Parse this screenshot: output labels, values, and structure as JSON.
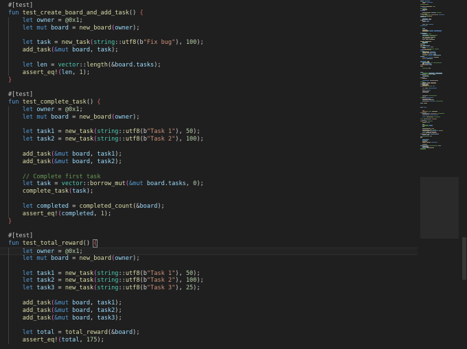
{
  "editor": {
    "language": "move",
    "lines": [
      [
        [
          "#[test]",
          "attr"
        ]
      ],
      [
        [
          "fun ",
          "kw"
        ],
        [
          "test_create_board_and_add_task",
          "fn"
        ],
        [
          "() ",
          "punct"
        ],
        [
          "{",
          "brace"
        ]
      ],
      [
        [
          "    let ",
          "kw"
        ],
        [
          "owner",
          "var"
        ],
        [
          " = ",
          "punct"
        ],
        [
          "@0x1",
          "num"
        ],
        [
          ";",
          "punct"
        ]
      ],
      [
        [
          "    let mut ",
          "kw"
        ],
        [
          "board",
          "var"
        ],
        [
          " = ",
          "punct"
        ],
        [
          "new_board",
          "fn"
        ],
        [
          "(",
          "paren"
        ],
        [
          "owner",
          "var"
        ],
        [
          ");",
          "punct"
        ]
      ],
      [
        [
          "",
          ""
        ]
      ],
      [
        [
          "    let ",
          "kw"
        ],
        [
          "task",
          "var"
        ],
        [
          " = ",
          "punct"
        ],
        [
          "new_task",
          "fn"
        ],
        [
          "(",
          "paren"
        ],
        [
          "string",
          "ns"
        ],
        [
          "::",
          "punct"
        ],
        [
          "utf8",
          "fn"
        ],
        [
          "(b",
          "punct"
        ],
        [
          "\"Fix bug\"",
          "str"
        ],
        [
          "), ",
          "punct"
        ],
        [
          "100",
          "num"
        ],
        [
          ");",
          "punct"
        ]
      ],
      [
        [
          "    ",
          "punct"
        ],
        [
          "add_task",
          "fn"
        ],
        [
          "(",
          "paren"
        ],
        [
          "&mut ",
          "kw"
        ],
        [
          "board",
          "var"
        ],
        [
          ", ",
          "punct"
        ],
        [
          "task",
          "var"
        ],
        [
          ");",
          "punct"
        ]
      ],
      [
        [
          "",
          ""
        ]
      ],
      [
        [
          "    let ",
          "kw"
        ],
        [
          "len",
          "var"
        ],
        [
          " = ",
          "punct"
        ],
        [
          "vector",
          "ns"
        ],
        [
          "::",
          "punct"
        ],
        [
          "length",
          "fn"
        ],
        [
          "(&",
          "punct"
        ],
        [
          "board",
          "var"
        ],
        [
          ".",
          "punct"
        ],
        [
          "tasks",
          "var"
        ],
        [
          ");",
          "punct"
        ]
      ],
      [
        [
          "    ",
          "punct"
        ],
        [
          "assert_eq!",
          "macro"
        ],
        [
          "(",
          "paren"
        ],
        [
          "len",
          "var"
        ],
        [
          ", ",
          "punct"
        ],
        [
          "1",
          "num"
        ],
        [
          ");",
          "punct"
        ]
      ],
      [
        [
          "}",
          "brace"
        ]
      ],
      [
        [
          "",
          ""
        ]
      ],
      [
        [
          "#[test]",
          "attr"
        ]
      ],
      [
        [
          "fun ",
          "kw"
        ],
        [
          "test_complete_task",
          "fn"
        ],
        [
          "() ",
          "punct"
        ],
        [
          "{",
          "brace"
        ]
      ],
      [
        [
          "    let ",
          "kw"
        ],
        [
          "owner",
          "var"
        ],
        [
          " = ",
          "punct"
        ],
        [
          "@0x1",
          "num"
        ],
        [
          ";",
          "punct"
        ]
      ],
      [
        [
          "    let mut ",
          "kw"
        ],
        [
          "board",
          "var"
        ],
        [
          " = ",
          "punct"
        ],
        [
          "new_board",
          "fn"
        ],
        [
          "(",
          "paren"
        ],
        [
          "owner",
          "var"
        ],
        [
          ");",
          "punct"
        ]
      ],
      [
        [
          "",
          ""
        ]
      ],
      [
        [
          "    let ",
          "kw"
        ],
        [
          "task1",
          "var"
        ],
        [
          " = ",
          "punct"
        ],
        [
          "new_task",
          "fn"
        ],
        [
          "(",
          "paren"
        ],
        [
          "string",
          "ns"
        ],
        [
          "::",
          "punct"
        ],
        [
          "utf8",
          "fn"
        ],
        [
          "(b",
          "punct"
        ],
        [
          "\"Task 1\"",
          "str"
        ],
        [
          "), ",
          "punct"
        ],
        [
          "50",
          "num"
        ],
        [
          ");",
          "punct"
        ]
      ],
      [
        [
          "    let ",
          "kw"
        ],
        [
          "task2",
          "var"
        ],
        [
          " = ",
          "punct"
        ],
        [
          "new_task",
          "fn"
        ],
        [
          "(",
          "paren"
        ],
        [
          "string",
          "ns"
        ],
        [
          "::",
          "punct"
        ],
        [
          "utf8",
          "fn"
        ],
        [
          "(b",
          "punct"
        ],
        [
          "\"Task 2\"",
          "str"
        ],
        [
          "), ",
          "punct"
        ],
        [
          "100",
          "num"
        ],
        [
          ");",
          "punct"
        ]
      ],
      [
        [
          "",
          ""
        ]
      ],
      [
        [
          "    ",
          "punct"
        ],
        [
          "add_task",
          "fn"
        ],
        [
          "(",
          "paren"
        ],
        [
          "&mut ",
          "kw"
        ],
        [
          "board",
          "var"
        ],
        [
          ", ",
          "punct"
        ],
        [
          "task1",
          "var"
        ],
        [
          ");",
          "punct"
        ]
      ],
      [
        [
          "    ",
          "punct"
        ],
        [
          "add_task",
          "fn"
        ],
        [
          "(",
          "paren"
        ],
        [
          "&mut ",
          "kw"
        ],
        [
          "board",
          "var"
        ],
        [
          ", ",
          "punct"
        ],
        [
          "task2",
          "var"
        ],
        [
          ");",
          "punct"
        ]
      ],
      [
        [
          "",
          ""
        ]
      ],
      [
        [
          "    // Complete first task",
          "cmt"
        ]
      ],
      [
        [
          "    let ",
          "kw"
        ],
        [
          "task",
          "var"
        ],
        [
          " = ",
          "punct"
        ],
        [
          "vector",
          "ns"
        ],
        [
          "::",
          "punct"
        ],
        [
          "borrow_mut",
          "fn"
        ],
        [
          "(",
          "paren"
        ],
        [
          "&mut ",
          "kw"
        ],
        [
          "board",
          "var"
        ],
        [
          ".",
          "punct"
        ],
        [
          "tasks",
          "var"
        ],
        [
          ", ",
          "punct"
        ],
        [
          "0",
          "num"
        ],
        [
          ");",
          "punct"
        ]
      ],
      [
        [
          "    ",
          "punct"
        ],
        [
          "complete_task",
          "fn"
        ],
        [
          "(",
          "paren"
        ],
        [
          "task",
          "var"
        ],
        [
          ");",
          "punct"
        ]
      ],
      [
        [
          "",
          ""
        ]
      ],
      [
        [
          "    let ",
          "kw"
        ],
        [
          "completed",
          "var"
        ],
        [
          " = ",
          "punct"
        ],
        [
          "completed_count",
          "fn"
        ],
        [
          "(&",
          "punct"
        ],
        [
          "board",
          "var"
        ],
        [
          ");",
          "punct"
        ]
      ],
      [
        [
          "    ",
          "punct"
        ],
        [
          "assert_eq!",
          "macro"
        ],
        [
          "(",
          "paren"
        ],
        [
          "completed",
          "var"
        ],
        [
          ", ",
          "punct"
        ],
        [
          "1",
          "num"
        ],
        [
          ");",
          "punct"
        ]
      ],
      [
        [
          "}",
          "brace"
        ]
      ],
      [
        [
          "",
          ""
        ]
      ],
      [
        [
          "#[test]",
          "attr"
        ]
      ],
      [
        [
          "fun ",
          "kw"
        ],
        [
          "test_total_reward",
          "fn"
        ],
        [
          "() ",
          "punct"
        ],
        [
          "{",
          "brace-box"
        ]
      ],
      [
        [
          "    let ",
          "kw"
        ],
        [
          "owner",
          "var"
        ],
        [
          " = ",
          "punct"
        ],
        [
          "@0x1",
          "num"
        ],
        [
          ";",
          "punct"
        ]
      ],
      [
        [
          "    let mut ",
          "kw"
        ],
        [
          "board",
          "var"
        ],
        [
          " = ",
          "punct"
        ],
        [
          "new_board",
          "fn"
        ],
        [
          "(",
          "paren"
        ],
        [
          "owner",
          "var"
        ],
        [
          ");",
          "punct"
        ]
      ],
      [
        [
          "",
          ""
        ]
      ],
      [
        [
          "    let ",
          "kw"
        ],
        [
          "task1",
          "var"
        ],
        [
          " = ",
          "punct"
        ],
        [
          "new_task",
          "fn"
        ],
        [
          "(",
          "paren"
        ],
        [
          "string",
          "ns"
        ],
        [
          "::",
          "punct"
        ],
        [
          "utf8",
          "fn"
        ],
        [
          "(b",
          "punct"
        ],
        [
          "\"Task 1\"",
          "str"
        ],
        [
          "), ",
          "punct"
        ],
        [
          "50",
          "num"
        ],
        [
          ");",
          "punct"
        ]
      ],
      [
        [
          "    let ",
          "kw"
        ],
        [
          "task2",
          "var"
        ],
        [
          " = ",
          "punct"
        ],
        [
          "new_task",
          "fn"
        ],
        [
          "(",
          "paren"
        ],
        [
          "string",
          "ns"
        ],
        [
          "::",
          "punct"
        ],
        [
          "utf8",
          "fn"
        ],
        [
          "(b",
          "punct"
        ],
        [
          "\"Task 2\"",
          "str"
        ],
        [
          "), ",
          "punct"
        ],
        [
          "100",
          "num"
        ],
        [
          ");",
          "punct"
        ]
      ],
      [
        [
          "    let ",
          "kw"
        ],
        [
          "task3",
          "var"
        ],
        [
          " = ",
          "punct"
        ],
        [
          "new_task",
          "fn"
        ],
        [
          "(",
          "paren"
        ],
        [
          "string",
          "ns"
        ],
        [
          "::",
          "punct"
        ],
        [
          "utf8",
          "fn"
        ],
        [
          "(b",
          "punct"
        ],
        [
          "\"Task 3\"",
          "str"
        ],
        [
          "), ",
          "punct"
        ],
        [
          "25",
          "num"
        ],
        [
          ");",
          "punct"
        ]
      ],
      [
        [
          "",
          ""
        ]
      ],
      [
        [
          "    ",
          "punct"
        ],
        [
          "add_task",
          "fn"
        ],
        [
          "(",
          "paren"
        ],
        [
          "&mut ",
          "kw"
        ],
        [
          "board",
          "var"
        ],
        [
          ", ",
          "punct"
        ],
        [
          "task1",
          "var"
        ],
        [
          ");",
          "punct"
        ]
      ],
      [
        [
          "    ",
          "punct"
        ],
        [
          "add_task",
          "fn"
        ],
        [
          "(",
          "paren"
        ],
        [
          "&mut ",
          "kw"
        ],
        [
          "board",
          "var"
        ],
        [
          ", ",
          "punct"
        ],
        [
          "task2",
          "var"
        ],
        [
          ");",
          "punct"
        ]
      ],
      [
        [
          "    ",
          "punct"
        ],
        [
          "add_task",
          "fn"
        ],
        [
          "(",
          "paren"
        ],
        [
          "&mut ",
          "kw"
        ],
        [
          "board",
          "var"
        ],
        [
          ", ",
          "punct"
        ],
        [
          "task3",
          "var"
        ],
        [
          ");",
          "punct"
        ]
      ],
      [
        [
          "",
          ""
        ]
      ],
      [
        [
          "    let ",
          "kw"
        ],
        [
          "total",
          "var"
        ],
        [
          " = ",
          "punct"
        ],
        [
          "total_reward",
          "fn"
        ],
        [
          "(&",
          "punct"
        ],
        [
          "board",
          "var"
        ],
        [
          ");",
          "punct"
        ]
      ],
      [
        [
          "    ",
          "punct"
        ],
        [
          "assert_eq!",
          "macro"
        ],
        [
          "(",
          "paren"
        ],
        [
          "total",
          "var"
        ],
        [
          ", ",
          "punct"
        ],
        [
          "175",
          "num"
        ],
        [
          ");",
          "punct"
        ]
      ]
    ]
  },
  "colors": {
    "background": "#1f1f1f",
    "keyword": "#569cd6",
    "function": "#dcdcaa",
    "variable": "#9cdcfe",
    "string": "#ce9178",
    "number": "#b5cea8",
    "comment": "#6a9955"
  }
}
